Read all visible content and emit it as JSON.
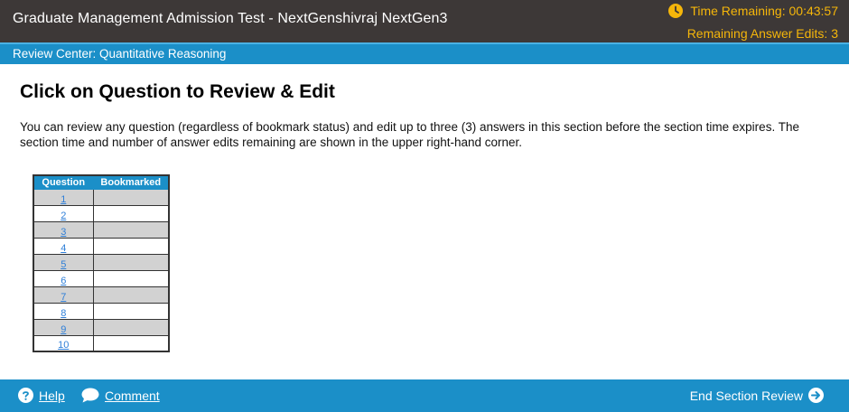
{
  "header": {
    "app_title": "Graduate Management Admission Test - NextGenshivraj NextGen3",
    "time_remaining": "Time Remaining: 00:43:57",
    "remaining_edits": "Remaining Answer Edits: 3",
    "accent_color": "#f5b60a"
  },
  "section_bar": {
    "title": "Review Center: Quantitative Reasoning",
    "color": "#1b8fc8"
  },
  "main": {
    "page_title": "Click on Question to Review & Edit",
    "instructions": "You can review any question (regardless of bookmark status) and edit up to three (3) answers in this section before the section time expires. The section time and number of answer edits remaining are shown in the upper right-hand corner."
  },
  "table": {
    "headers": [
      "Question",
      "Bookmarked"
    ],
    "rows": [
      {
        "question": "1",
        "bookmarked": ""
      },
      {
        "question": "2",
        "bookmarked": ""
      },
      {
        "question": "3",
        "bookmarked": ""
      },
      {
        "question": "4",
        "bookmarked": ""
      },
      {
        "question": "5",
        "bookmarked": ""
      },
      {
        "question": "6",
        "bookmarked": ""
      },
      {
        "question": "7",
        "bookmarked": ""
      },
      {
        "question": "8",
        "bookmarked": ""
      },
      {
        "question": "9",
        "bookmarked": ""
      },
      {
        "question": "10",
        "bookmarked": ""
      }
    ]
  },
  "footer": {
    "help_label": "Help",
    "comment_label": "Comment",
    "end_review_label": "End Section Review",
    "icons": [
      "help-icon",
      "comment-icon",
      "arrow-right-circle-icon"
    ]
  }
}
